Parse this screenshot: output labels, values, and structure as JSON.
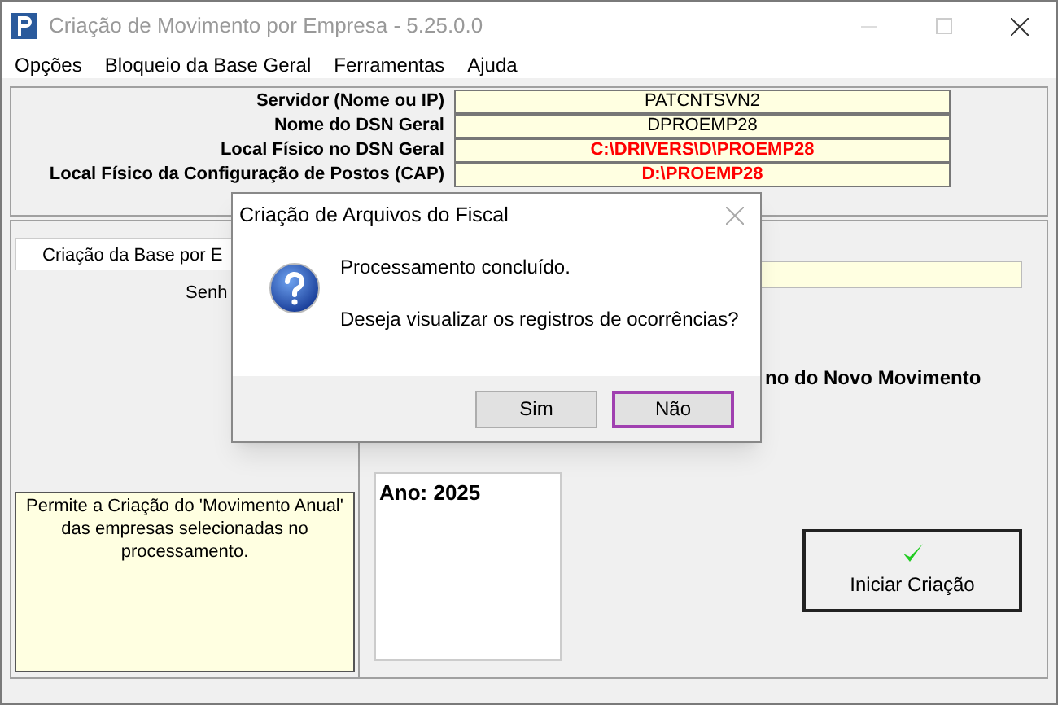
{
  "window": {
    "title": "Criação de Movimento por Empresa - 5.25.0.0"
  },
  "menu": [
    "Opções",
    "Bloqueio da Base Geral",
    "Ferramentas",
    "Ajuda"
  ],
  "settings": [
    {
      "label": "Servidor (Nome ou IP)",
      "value": "PATCNTSVN2",
      "highlight": false
    },
    {
      "label": "Nome do DSN Geral",
      "value": "DPROEMP28",
      "highlight": false
    },
    {
      "label": "Local Físico no DSN Geral",
      "value": "C:\\DRIVERS\\D\\PROEMP28",
      "highlight": true
    },
    {
      "label": "Local Físico da Configuração de Postos (CAP)",
      "value": "D:\\PROEMP28",
      "highlight": true
    }
  ],
  "tab": {
    "label": "Criação da Base por E",
    "selected": true
  },
  "password_label": "Senh",
  "year_label": "no do Novo Movimento",
  "years": [
    "Ano: 2025"
  ],
  "info": "Permite a Criação do 'Movimento Anual' das empresas selecionadas no processamento.",
  "start_button": "Iniciar Criação",
  "dialog": {
    "title": "Criação de Arquivos do Fiscal",
    "lines": [
      "Processamento concluído.",
      "Deseja visualizar os registros de ocorrências?"
    ],
    "buttons": [
      {
        "label": "Sim",
        "focused": false
      },
      {
        "label": "Não",
        "focused": true
      }
    ]
  }
}
